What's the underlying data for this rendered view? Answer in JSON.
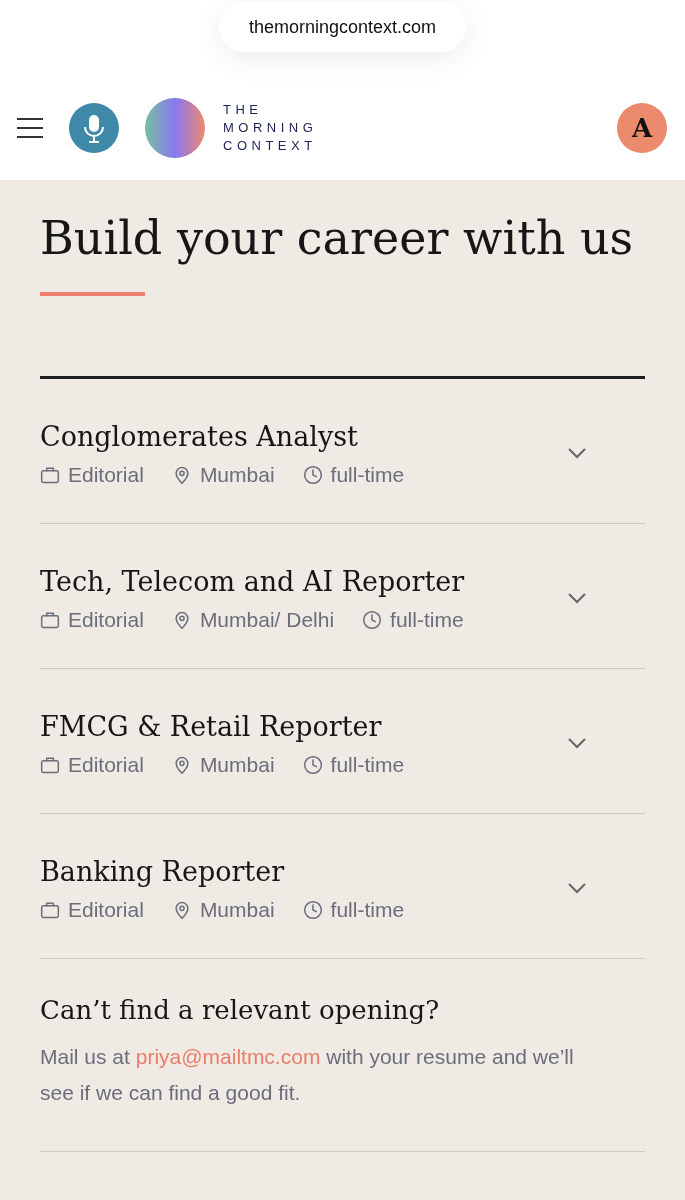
{
  "address_bar": {
    "url": "themorningcontext.com"
  },
  "header": {
    "logo_text": [
      "THE",
      "MORNING",
      "CONTEXT"
    ],
    "avatar": "A"
  },
  "title": "Build your career with us",
  "jobs": [
    {
      "title": "Conglomerates Analyst",
      "team": "Editorial",
      "location": "Mumbai",
      "type": "full-time",
      "expanded": false
    },
    {
      "title": "Tech, Telecom and AI Reporter",
      "team": "Editorial",
      "location": "Mumbai/ Delhi",
      "type": "full-time",
      "expanded": false
    },
    {
      "title": "FMCG & Retail Reporter",
      "team": "Editorial",
      "location": "Mumbai",
      "type": "full-time",
      "expanded": false
    },
    {
      "title": "Banking Reporter",
      "team": "Editorial",
      "location": "Mumbai",
      "type": "full-time",
      "expanded": false
    }
  ],
  "footer_note": {
    "heading": "Can’t find a relevant opening?",
    "text_before": "Mail us at ",
    "email": "priya@mailtmc.com",
    "text_after": " with your resume and we’ll see if we can find a good fit."
  }
}
